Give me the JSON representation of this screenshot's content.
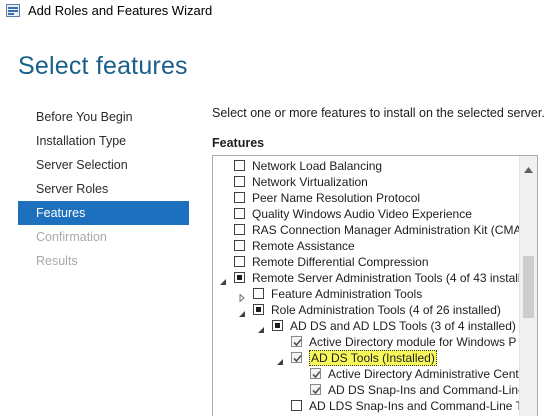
{
  "window": {
    "title": "Add Roles and Features Wizard"
  },
  "page": {
    "title": "Select features",
    "instruction": "Select one or more features to install on the selected server.",
    "features_label": "Features"
  },
  "nav": {
    "items": [
      {
        "label": "Before You Begin",
        "state": "normal"
      },
      {
        "label": "Installation Type",
        "state": "normal"
      },
      {
        "label": "Server Selection",
        "state": "normal"
      },
      {
        "label": "Server Roles",
        "state": "normal"
      },
      {
        "label": "Features",
        "state": "active"
      },
      {
        "label": "Confirmation",
        "state": "disabled"
      },
      {
        "label": "Results",
        "state": "disabled"
      }
    ]
  },
  "tree": {
    "rows": [
      {
        "label": "Network Load Balancing",
        "level": 0,
        "check": "unchecked",
        "expander": "none"
      },
      {
        "label": "Network Virtualization",
        "level": 0,
        "check": "unchecked",
        "expander": "none"
      },
      {
        "label": "Peer Name Resolution Protocol",
        "level": 0,
        "check": "unchecked",
        "expander": "none"
      },
      {
        "label": "Quality Windows Audio Video Experience",
        "level": 0,
        "check": "unchecked",
        "expander": "none"
      },
      {
        "label": "RAS Connection Manager Administration Kit (CMA",
        "level": 0,
        "check": "unchecked",
        "expander": "none"
      },
      {
        "label": "Remote Assistance",
        "level": 0,
        "check": "unchecked",
        "expander": "none"
      },
      {
        "label": "Remote Differential Compression",
        "level": 0,
        "check": "unchecked",
        "expander": "none"
      },
      {
        "label": "Remote Server Administration Tools (4 of 43 install",
        "level": 0,
        "check": "partial",
        "expander": "expanded"
      },
      {
        "label": "Feature Administration Tools",
        "level": 1,
        "check": "unchecked",
        "expander": "collapsed"
      },
      {
        "label": "Role Administration Tools (4 of 26 installed)",
        "level": 1,
        "check": "partial",
        "expander": "expanded"
      },
      {
        "label": "AD DS and AD LDS Tools (3 of 4 installed)",
        "level": 2,
        "check": "partial",
        "expander": "expanded"
      },
      {
        "label": "Active Directory module for Windows P",
        "level": 3,
        "check": "checked",
        "expander": "none"
      },
      {
        "label": "AD DS Tools (Installed)",
        "level": 3,
        "check": "checked",
        "expander": "expanded",
        "highlight": true
      },
      {
        "label": "Active Directory Administrative Cent",
        "level": 4,
        "check": "checked",
        "expander": "none"
      },
      {
        "label": "AD DS Snap-Ins and Command-Line",
        "level": 4,
        "check": "checked",
        "expander": "none"
      },
      {
        "label": "AD LDS Snap-Ins and Command-Line T",
        "level": 3,
        "check": "unchecked",
        "expander": "none"
      }
    ]
  },
  "colors": {
    "accent": "#1c70be",
    "title": "#1a5f8c",
    "highlight": "#f7f85a"
  }
}
